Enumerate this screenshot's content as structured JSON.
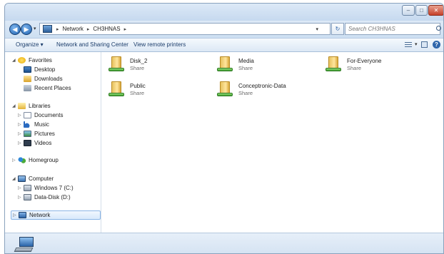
{
  "window": {
    "controls": {
      "minimize_icon": "minimize-icon",
      "maximize_icon": "maximize-icon",
      "close_icon": "close-icon"
    }
  },
  "address": {
    "crumbs": [
      "Network",
      "CH3HNAS"
    ],
    "search_placeholder": "Search CH3HNAS"
  },
  "toolbar": {
    "organize": "Organize ▾",
    "network_sharing": "Network and Sharing Center",
    "view_printers": "View remote printers"
  },
  "nav": {
    "favorites": "Favorites",
    "desktop": "Desktop",
    "downloads": "Downloads",
    "recent": "Recent Places",
    "libraries": "Libraries",
    "documents": "Documents",
    "music": "Music",
    "pictures": "Pictures",
    "videos": "Videos",
    "homegroup": "Homegroup",
    "computer": "Computer",
    "drive_c": "Windows 7 (C:)",
    "drive_d": "Data-Disk (D:)",
    "network": "Network"
  },
  "shares": [
    {
      "name": "Disk_2",
      "type": "Share"
    },
    {
      "name": "Media",
      "type": "Share"
    },
    {
      "name": "For-Everyone",
      "type": "Share"
    },
    {
      "name": "Public",
      "type": "Share"
    },
    {
      "name": "Conceptronic-Data",
      "type": "Share"
    }
  ],
  "colors": {
    "accent": "#2f66ab",
    "selection": "#d8e9fb",
    "share_pipe": "#3a9c2c"
  }
}
